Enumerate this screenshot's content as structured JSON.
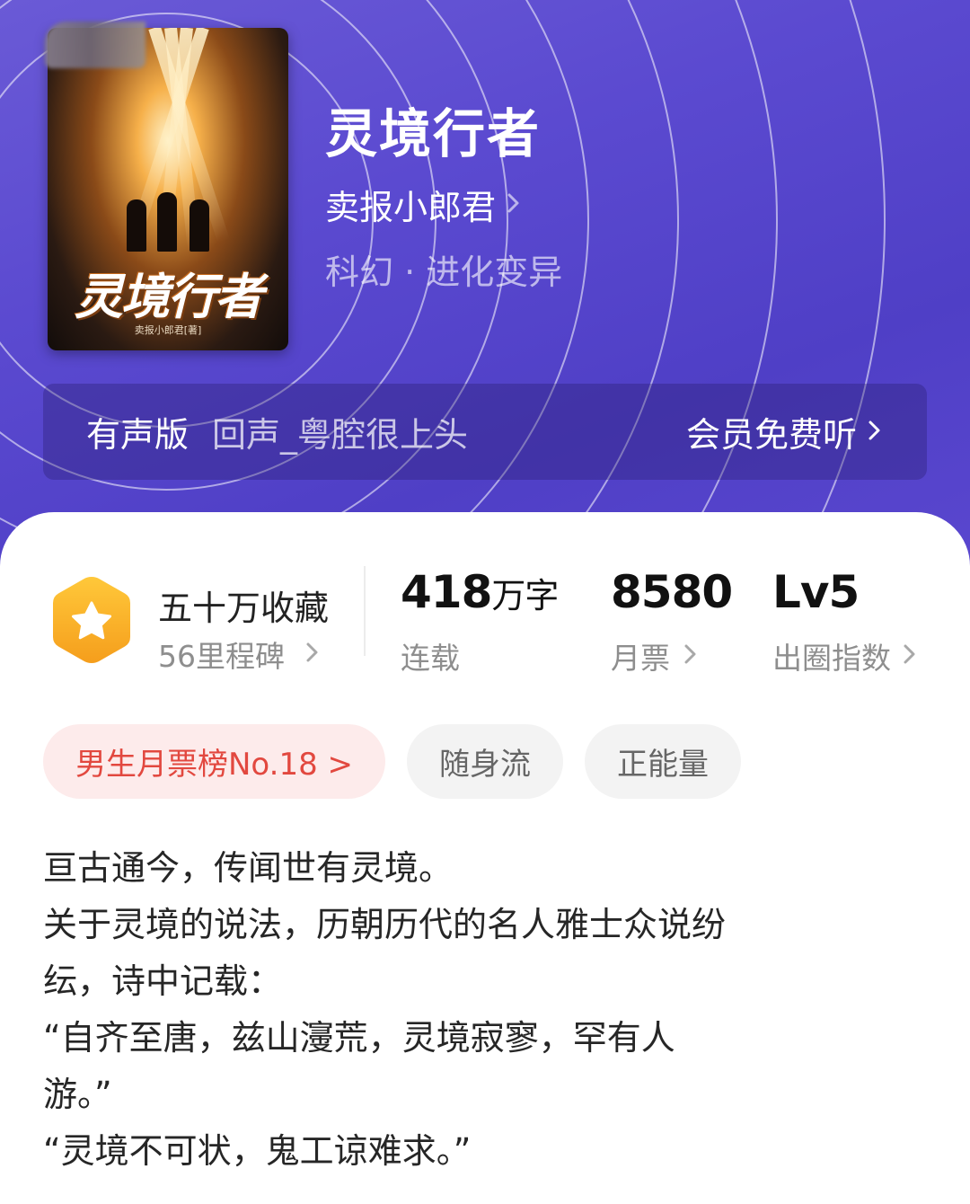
{
  "book": {
    "title": "灵境行者",
    "author": "卖报小郎君",
    "genre": "科幻 · 进化变异",
    "cover": {
      "title_art": "灵境行者",
      "author_credit": "卖报小郎君[著]"
    }
  },
  "audio": {
    "label": "有声版",
    "narrator": "回声_粤腔很上头",
    "action": "会员免费听"
  },
  "stats": {
    "collection": {
      "title": "五十万收藏",
      "subtitle": "56里程碑"
    },
    "words": {
      "value": "418",
      "unit": "万字",
      "label": "连载"
    },
    "monthly_votes": {
      "value": "8580",
      "label": "月票"
    },
    "influence": {
      "value": "Lv5",
      "label": "出圈指数"
    }
  },
  "tags": [
    {
      "label": "男生月票榜No.18 >"
    },
    {
      "label": "随身流"
    },
    {
      "label": "正能量"
    }
  ],
  "synopsis": [
    "亘古通今，传闻世有灵境。",
    "关于灵境的说法，历朝历代的名人雅士众说纷",
    "纭，诗中记载：",
    "“自齐至唐，兹山濅荒，灵境寂寥，罕有人",
    "游。”",
    "“灵境不可状，鬼工谅难求。”"
  ],
  "colors": {
    "header_purple": "#5b4ad0",
    "rank_tag_text": "#e2483f",
    "rank_tag_bg": "#fdebeb",
    "badge_orange": "#f7b52a"
  },
  "icons": {
    "author_chevron": "chevron-right-icon",
    "collection_badge": "star-hexagon-icon"
  }
}
